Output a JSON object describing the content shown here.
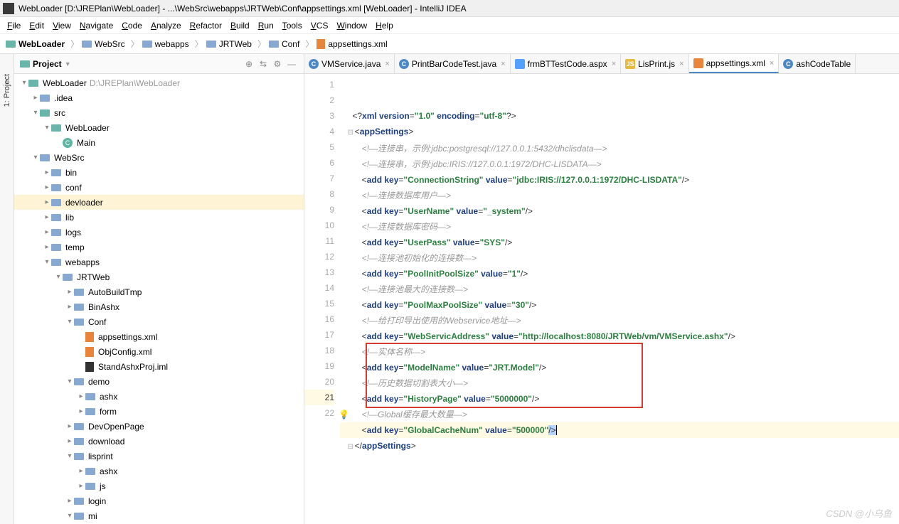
{
  "window": {
    "title": "WebLoader [D:\\JREPlan\\WebLoader] - ...\\WebSrc\\webapps\\JRTWeb\\Conf\\appsettings.xml [WebLoader] - IntelliJ IDEA"
  },
  "menu": [
    "File",
    "Edit",
    "View",
    "Navigate",
    "Code",
    "Analyze",
    "Refactor",
    "Build",
    "Run",
    "Tools",
    "VCS",
    "Window",
    "Help"
  ],
  "breadcrumb": [
    "WebLoader",
    "WebSrc",
    "webapps",
    "JRTWeb",
    "Conf",
    "appsettings.xml"
  ],
  "projectPanel": {
    "title": "Project"
  },
  "tree": [
    {
      "d": 0,
      "a": "▾",
      "i": "folder teal",
      "l": "WebLoader",
      "p": "D:\\JREPlan\\WebLoader"
    },
    {
      "d": 1,
      "a": "▸",
      "i": "folder",
      "l": ".idea"
    },
    {
      "d": 1,
      "a": "▾",
      "i": "folder teal",
      "l": "src"
    },
    {
      "d": 2,
      "a": "▾",
      "i": "folder teal",
      "l": "WebLoader"
    },
    {
      "d": 3,
      "a": "",
      "i": "c",
      "l": "Main"
    },
    {
      "d": 1,
      "a": "▾",
      "i": "folder",
      "l": "WebSrc"
    },
    {
      "d": 2,
      "a": "▸",
      "i": "folder",
      "l": "bin"
    },
    {
      "d": 2,
      "a": "▸",
      "i": "folder",
      "l": "conf"
    },
    {
      "d": 2,
      "a": "▸",
      "i": "folder",
      "l": "devloader",
      "sel": true
    },
    {
      "d": 2,
      "a": "▸",
      "i": "folder",
      "l": "lib"
    },
    {
      "d": 2,
      "a": "▸",
      "i": "folder",
      "l": "logs"
    },
    {
      "d": 2,
      "a": "▸",
      "i": "folder",
      "l": "temp"
    },
    {
      "d": 2,
      "a": "▾",
      "i": "folder",
      "l": "webapps"
    },
    {
      "d": 3,
      "a": "▾",
      "i": "folder",
      "l": "JRTWeb"
    },
    {
      "d": 4,
      "a": "▸",
      "i": "folder",
      "l": "AutoBuildTmp"
    },
    {
      "d": 4,
      "a": "▸",
      "i": "folder",
      "l": "BinAshx"
    },
    {
      "d": 4,
      "a": "▾",
      "i": "folder",
      "l": "Conf"
    },
    {
      "d": 5,
      "a": "",
      "i": "xml",
      "l": "appsettings.xml"
    },
    {
      "d": 5,
      "a": "",
      "i": "xml",
      "l": "ObjConfig.xml"
    },
    {
      "d": 5,
      "a": "",
      "i": "ij",
      "l": "StandAshxProj.iml"
    },
    {
      "d": 4,
      "a": "▾",
      "i": "folder",
      "l": "demo"
    },
    {
      "d": 5,
      "a": "▸",
      "i": "folder",
      "l": "ashx"
    },
    {
      "d": 5,
      "a": "▸",
      "i": "folder",
      "l": "form"
    },
    {
      "d": 4,
      "a": "▸",
      "i": "folder",
      "l": "DevOpenPage"
    },
    {
      "d": 4,
      "a": "▸",
      "i": "folder",
      "l": "download"
    },
    {
      "d": 4,
      "a": "▾",
      "i": "folder",
      "l": "lisprint"
    },
    {
      "d": 5,
      "a": "▸",
      "i": "folder",
      "l": "ashx"
    },
    {
      "d": 5,
      "a": "▸",
      "i": "folder",
      "l": "js"
    },
    {
      "d": 4,
      "a": "▸",
      "i": "folder",
      "l": "login"
    },
    {
      "d": 4,
      "a": "▾",
      "i": "folder",
      "l": "mi"
    }
  ],
  "tabs": [
    {
      "icon": "c",
      "label": "VMService.java",
      "close": true
    },
    {
      "icon": "c",
      "label": "PrintBarCodeTest.java",
      "close": true
    },
    {
      "icon": "web",
      "label": "frmBTTestCode.aspx",
      "close": true
    },
    {
      "icon": "js",
      "label": "LisPrint.js",
      "close": true
    },
    {
      "icon": "xml",
      "label": "appsettings.xml",
      "close": true,
      "active": true
    },
    {
      "icon": "c",
      "label": "ashCodeTable"
    }
  ],
  "code": {
    "lines": [
      {
        "n": 1,
        "html": "    <span class='punct'>&lt;?</span><span class='tag'>xml version</span><span class='punct'>=</span><span class='val'>\"1.0\"</span> <span class='tag'>encoding</span><span class='punct'>=</span><span class='val'>\"utf-8\"</span><span class='punct'>?&gt;</span>"
      },
      {
        "n": 2,
        "html": "  <span class='fold'>⊟</span><span class='punct'>&lt;</span><span class='tag'>appSettings</span><span class='punct'>&gt;</span>"
      },
      {
        "n": 3,
        "html": "        <span class='cmt'>&lt;!—连接串，示例:jdbc:postgresql://127.0.0.1:5432/dhclisdata—&gt;</span>"
      },
      {
        "n": 4,
        "html": "        <span class='cmt'>&lt;!—连接串，示例:jdbc:IRIS://127.0.0.1:1972/DHC-LISDATA—&gt;</span>"
      },
      {
        "n": 5,
        "html": "        <span class='punct'>&lt;</span><span class='tag'>add</span> <span class='attr'>key</span><span class='punct'>=</span><span class='val'>\"ConnectionString\"</span> <span class='attr'>value</span><span class='punct'>=</span><span class='val'>\"jdbc:IRIS://127.0.0.1:1972/DHC-LISDATA\"</span><span class='punct'>/&gt;</span>"
      },
      {
        "n": 6,
        "html": "        <span class='cmt'>&lt;!—连接数据库用户—&gt;</span>"
      },
      {
        "n": 7,
        "html": "        <span class='punct'>&lt;</span><span class='tag'>add</span> <span class='attr'>key</span><span class='punct'>=</span><span class='val'>\"UserName\"</span> <span class='attr'>value</span><span class='punct'>=</span><span class='val'>\"_system\"</span><span class='punct'>/&gt;</span>"
      },
      {
        "n": 8,
        "html": "        <span class='cmt'>&lt;!—连接数据库密码—&gt;</span>"
      },
      {
        "n": 9,
        "html": "        <span class='punct'>&lt;</span><span class='tag'>add</span> <span class='attr'>key</span><span class='punct'>=</span><span class='val'>\"UserPass\"</span> <span class='attr'>value</span><span class='punct'>=</span><span class='val'>\"SYS\"</span><span class='punct'>/&gt;</span>"
      },
      {
        "n": 10,
        "html": "        <span class='cmt'>&lt;!—连接池初始化的连接数—&gt;</span>"
      },
      {
        "n": 11,
        "html": "        <span class='punct'>&lt;</span><span class='tag'>add</span> <span class='attr'>key</span><span class='punct'>=</span><span class='val'>\"PoolInitPoolSize\"</span> <span class='attr'>value</span><span class='punct'>=</span><span class='val'>\"1\"</span><span class='punct'>/&gt;</span>"
      },
      {
        "n": 12,
        "html": "        <span class='cmt'>&lt;!—连接池最大的连接数—&gt;</span>"
      },
      {
        "n": 13,
        "html": "        <span class='punct'>&lt;</span><span class='tag'>add</span> <span class='attr'>key</span><span class='punct'>=</span><span class='val'>\"PoolMaxPoolSize\"</span> <span class='attr'>value</span><span class='punct'>=</span><span class='val'>\"30\"</span><span class='punct'>/&gt;</span>"
      },
      {
        "n": 14,
        "html": "        <span class='cmt'>&lt;!—给打印导出使用的Webservice地址—&gt;</span>"
      },
      {
        "n": 15,
        "html": "        <span class='punct'>&lt;</span><span class='tag'>add</span> <span class='attr'>key</span><span class='punct'>=</span><span class='val'>\"WebServicAddress\"</span> <span class='attr'>value</span><span class='punct'>=</span><span class='val'>\"http://localhost:8080/JRTWeb/vm/VMService.ashx\"</span><span class='punct'>/&gt;</span>"
      },
      {
        "n": 16,
        "html": "        <span class='cmt'>&lt;!—实体名称—&gt;</span>"
      },
      {
        "n": 17,
        "html": "        <span class='punct'>&lt;</span><span class='tag'>add</span> <span class='attr'>key</span><span class='punct'>=</span><span class='val'>\"ModelName\"</span> <span class='attr'>value</span><span class='punct'>=</span><span class='val'>\"JRT.Model\"</span><span class='punct'>/&gt;</span>"
      },
      {
        "n": 18,
        "html": "        <span class='cmt'>&lt;!—历史数据切割表大小—&gt;</span>"
      },
      {
        "n": 19,
        "html": "        <span class='punct'>&lt;</span><span class='tag'>add</span> <span class='attr'>key</span><span class='punct'>=</span><span class='val'>\"HistoryPage\"</span> <span class='attr'>value</span><span class='punct'>=</span><span class='val'>\"5000000\"</span><span class='punct'>/&gt;</span>"
      },
      {
        "n": 20,
        "html": "<span class='lightbulb'>💡</span>        <span class='cmt'>&lt;!—Global缓存最大数量—&gt;</span>"
      },
      {
        "n": 21,
        "hl": true,
        "html": "        <span class='punct'>&lt;</span><span class='tag'>add</span> <span class='attr'>key</span><span class='punct'>=</span><span class='val'>\"GlobalCacheNum\"</span> <span class='attr'>value</span><span class='punct'>=</span><span class='val'>\"500000\"</span><span class='punct selection-end'>/&gt;</span><span class='caret'></span>"
      },
      {
        "n": 22,
        "html": "  <span class='fold'>⊟</span><span class='punct'>&lt;/</span><span class='tag'>appSettings</span><span class='punct'>&gt;</span>"
      }
    ]
  },
  "watermark": "CSDN @小乌鱼"
}
